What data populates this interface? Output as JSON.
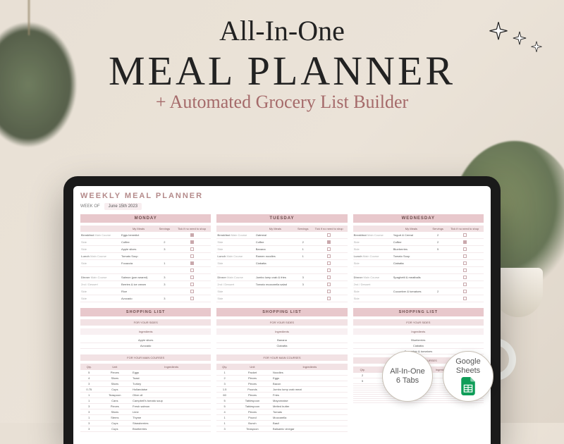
{
  "hero": {
    "line1": "All-In-One",
    "line2": "MEAL PLANNER",
    "line3": "+ Automated Grocery List Builder"
  },
  "badges": {
    "b1_line1": "All-In-One",
    "b1_line2": "6 Tabs",
    "b2_line1": "Google",
    "b2_line2": "Sheets"
  },
  "planner": {
    "title": "WEEKLY MEAL PLANNER",
    "week_label": "WEEK OF",
    "week_value": "June 15th 2023",
    "col_headers": {
      "meals": "My Meals",
      "servings": "Servings",
      "tick": "Tick if no need to shop"
    },
    "meal_row_labels": [
      "Breakfast",
      "",
      "",
      "Lunch",
      "",
      "",
      "Dinner",
      "",
      "",
      ""
    ],
    "sub_labels": [
      "Main Course",
      "Side",
      "Side",
      "Main Course",
      "Side",
      "Main Course",
      "2nd / Dessert",
      "Side",
      "Side"
    ],
    "shopping_list_header": "SHOPPING LIST",
    "sides_header": "FOR YOUR SIDES",
    "mains_header": "FOR YOUR MAIN COURSES",
    "ingredients_label": "Ingredients",
    "qty_label": "Qty.",
    "unit_label": "Unit",
    "days": [
      {
        "name": "MONDAY",
        "rows": [
          {
            "slot": "Breakfast",
            "type": "Main Course",
            "meal": "Eggs benedict",
            "serv": "",
            "chk": true
          },
          {
            "slot": "",
            "type": "Side",
            "meal": "Coffee",
            "serv": "2",
            "chk": true
          },
          {
            "slot": "",
            "type": "Side",
            "meal": "Apple slices",
            "serv": "3",
            "chk": false
          },
          {
            "slot": "Lunch",
            "type": "Main Course",
            "meal": "Tomato Soup",
            "serv": "",
            "chk": false
          },
          {
            "slot": "",
            "type": "Side",
            "meal": "Focaccia",
            "serv": "1",
            "chk": true
          },
          {
            "slot": "",
            "type": "",
            "meal": "",
            "serv": "",
            "chk": false
          },
          {
            "slot": "Dinner",
            "type": "Main Course",
            "meal": "Salmon (pan seared)",
            "serv": "3",
            "chk": false
          },
          {
            "slot": "",
            "type": "2nd / Dessert",
            "meal": "Berries & ice cream",
            "serv": "3",
            "chk": false
          },
          {
            "slot": "",
            "type": "Side",
            "meal": "Rice",
            "serv": "",
            "chk": false
          },
          {
            "slot": "",
            "type": "Side",
            "meal": "Avocado",
            "serv": "3",
            "chk": false
          }
        ],
        "sides_ing": [
          "Apple slices",
          "Avocado"
        ],
        "mains": [
          {
            "qty": "5",
            "unit": "Pieces",
            "ing": "Eggs"
          },
          {
            "qty": "4",
            "unit": "Slices",
            "ing": "Toast"
          },
          {
            "qty": "3",
            "unit": "Slices",
            "ing": "Turkey"
          },
          {
            "qty": "0.75",
            "unit": "Cups",
            "ing": "Hollandaise"
          },
          {
            "qty": "1",
            "unit": "Teaspoon",
            "ing": "Olive oil"
          },
          {
            "qty": "1",
            "unit": "Cans",
            "ing": "Campbell's tomato soup"
          },
          {
            "qty": "3",
            "unit": "Pieces",
            "ing": "Fresh salmon"
          },
          {
            "qty": "3",
            "unit": "Slices",
            "ing": "Lime"
          },
          {
            "qty": "1",
            "unit": "Stems",
            "ing": "Thyme"
          },
          {
            "qty": "3",
            "unit": "Cups",
            "ing": "Strawberries"
          },
          {
            "qty": "3",
            "unit": "Cups",
            "ing": "Blueberries"
          }
        ]
      },
      {
        "name": "TUESDAY",
        "rows": [
          {
            "slot": "Breakfast",
            "type": "Main Course",
            "meal": "Oatmeal",
            "serv": "",
            "chk": false
          },
          {
            "slot": "",
            "type": "Side",
            "meal": "Coffee",
            "serv": "2",
            "chk": true
          },
          {
            "slot": "",
            "type": "Side",
            "meal": "Banana",
            "serv": "1",
            "chk": false
          },
          {
            "slot": "Lunch",
            "type": "Main Course",
            "meal": "Ramen noodles",
            "serv": "1",
            "chk": false
          },
          {
            "slot": "",
            "type": "Side",
            "meal": "Ciabatta",
            "serv": "",
            "chk": false
          },
          {
            "slot": "",
            "type": "",
            "meal": "",
            "serv": "",
            "chk": false
          },
          {
            "slot": "Dinner",
            "type": "Main Course",
            "meal": "Jumbo lump crab & fries",
            "serv": "3",
            "chk": false
          },
          {
            "slot": "",
            "type": "2nd / Dessert",
            "meal": "Tomato mozzarella salad",
            "serv": "3",
            "chk": false
          },
          {
            "slot": "",
            "type": "Side",
            "meal": "",
            "serv": "",
            "chk": false
          },
          {
            "slot": "",
            "type": "Side",
            "meal": "",
            "serv": "",
            "chk": false
          }
        ],
        "sides_ing": [
          "Banana",
          "Ciabatta"
        ],
        "mains": [
          {
            "qty": "1",
            "unit": "Packet",
            "ing": "Noodles"
          },
          {
            "qty": "2",
            "unit": "Pieces",
            "ing": "Eggs"
          },
          {
            "qty": "3",
            "unit": "Pieces",
            "ing": "Bacon"
          },
          {
            "qty": "1.5",
            "unit": "Pounds",
            "ing": "Jumbo lump crab meat"
          },
          {
            "qty": "60",
            "unit": "Pieces",
            "ing": "Fries"
          },
          {
            "qty": "5",
            "unit": "Tablespoon",
            "ing": "Mayonnaise"
          },
          {
            "qty": "5",
            "unit": "Tablespoon",
            "ing": "Melted butter"
          },
          {
            "qty": "4",
            "unit": "Pieces",
            "ing": "Tomato"
          },
          {
            "qty": "1",
            "unit": "Pound",
            "ing": "Mozzarella"
          },
          {
            "qty": "1",
            "unit": "Bunch",
            "ing": "Basil"
          },
          {
            "qty": "3",
            "unit": "Teaspoon",
            "ing": "Balsamic vinegar"
          }
        ]
      },
      {
        "name": "WEDNESDAY",
        "rows": [
          {
            "slot": "Breakfast",
            "type": "Main Course",
            "meal": "Yogurt & Cereal",
            "serv": "2",
            "chk": false
          },
          {
            "slot": "",
            "type": "Side",
            "meal": "Coffee",
            "serv": "2",
            "chk": true
          },
          {
            "slot": "",
            "type": "Side",
            "meal": "Blueberries",
            "serv": "5",
            "chk": false
          },
          {
            "slot": "Lunch",
            "type": "Main Course",
            "meal": "Tomato Soup",
            "serv": "",
            "chk": false
          },
          {
            "slot": "",
            "type": "Side",
            "meal": "Ciabatta",
            "serv": "",
            "chk": false
          },
          {
            "slot": "",
            "type": "",
            "meal": "",
            "serv": "",
            "chk": false
          },
          {
            "slot": "Dinner",
            "type": "Main Course",
            "meal": "Spaghetti & meatballs",
            "serv": "",
            "chk": false
          },
          {
            "slot": "",
            "type": "2nd / Dessert",
            "meal": "",
            "serv": "",
            "chk": false
          },
          {
            "slot": "",
            "type": "Side",
            "meal": "Cucumber & tomatoes",
            "serv": "2",
            "chk": false
          },
          {
            "slot": "",
            "type": "Side",
            "meal": "",
            "serv": "",
            "chk": false
          }
        ],
        "sides_ing": [
          "Blueberries",
          "Ciabatta",
          "Cucumber & tomatoes"
        ],
        "mains": [
          {
            "qty": "2",
            "unit": "Cans",
            "ing": "Tomato canned soup"
          },
          {
            "qty": "5",
            "unit": "Pieces",
            "ing": "Eggs"
          },
          {
            "qty": "",
            "unit": "",
            "ing": ""
          },
          {
            "qty": "",
            "unit": "",
            "ing": ""
          },
          {
            "qty": "",
            "unit": "",
            "ing": ""
          },
          {
            "qty": "",
            "unit": "",
            "ing": ""
          },
          {
            "qty": "",
            "unit": "",
            "ing": ""
          },
          {
            "qty": "",
            "unit": "",
            "ing": ""
          },
          {
            "qty": "",
            "unit": "",
            "ing": ""
          },
          {
            "qty": "",
            "unit": "",
            "ing": ""
          },
          {
            "qty": "",
            "unit": "",
            "ing": ""
          }
        ]
      }
    ]
  }
}
